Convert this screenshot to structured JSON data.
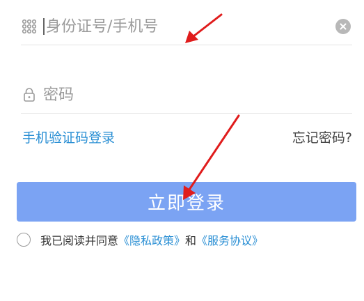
{
  "form": {
    "account_placeholder": "身份证号/手机号",
    "password_placeholder": "密码",
    "sms_login_label": "手机验证码登录",
    "forgot_password_label": "忘记密码?",
    "login_button_label": "立即登录"
  },
  "agreement": {
    "prefix": "我已阅读并同意",
    "privacy_label": "《隐私政策》",
    "conjunction": "和",
    "service_label": "《服务协议》"
  },
  "icons": {
    "account": "keypad-icon",
    "password": "lock-icon",
    "clear": "clear-icon"
  },
  "colors": {
    "link": "#2a8fd4",
    "button": "#7ba3f3",
    "annotation_arrow": "#e01c1c"
  }
}
